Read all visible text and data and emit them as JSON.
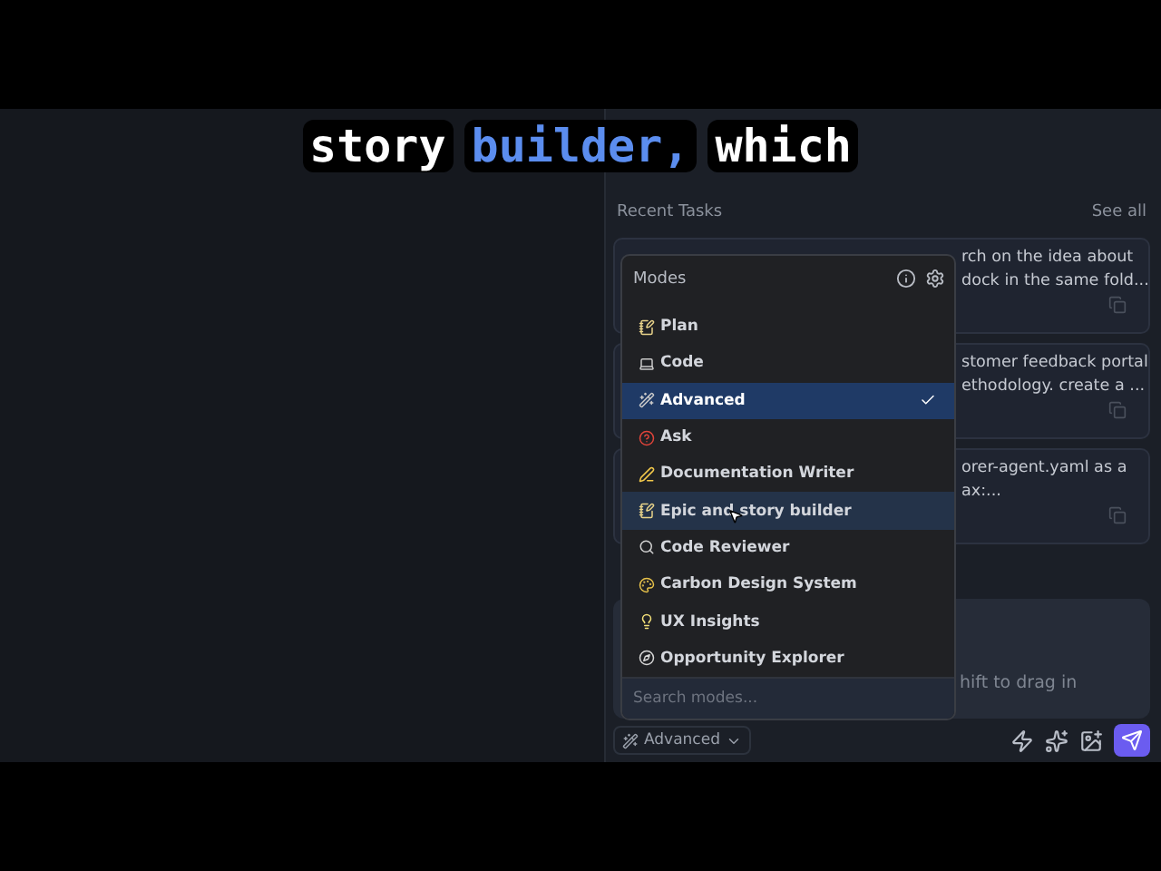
{
  "caption": {
    "words": [
      {
        "text": "story",
        "highlighted": false
      },
      {
        "text": "builder,",
        "highlighted": true
      },
      {
        "text": "which",
        "highlighted": false
      }
    ]
  },
  "recent_tasks": {
    "title": "Recent Tasks",
    "see_all": "See all",
    "tasks": [
      {
        "lines": [
          "rch on the idea about",
          "dock in the same fold..."
        ]
      },
      {
        "lines": [
          "stomer feedback portal",
          "ethodology. create a ..."
        ]
      },
      {
        "lines": [
          "orer-agent.yaml as a",
          "ax:..."
        ]
      }
    ]
  },
  "input": {
    "hint": "hift to drag in"
  },
  "modes_menu": {
    "title": "Modes",
    "items": [
      {
        "label": "Plan",
        "selected": false,
        "hovered": false
      },
      {
        "label": "Code",
        "selected": false,
        "hovered": false
      },
      {
        "label": "Advanced",
        "selected": true,
        "hovered": false
      },
      {
        "label": "Ask",
        "selected": false,
        "hovered": false
      },
      {
        "label": "Documentation Writer",
        "selected": false,
        "hovered": false
      },
      {
        "label": "Epic and story builder",
        "selected": false,
        "hovered": true
      },
      {
        "label": "Code Reviewer",
        "selected": false,
        "hovered": false
      },
      {
        "label": "Carbon Design System",
        "selected": false,
        "hovered": false
      },
      {
        "label": "UX Insights",
        "selected": false,
        "hovered": false
      },
      {
        "label": "Opportunity Explorer",
        "selected": false,
        "hovered": false
      }
    ],
    "search": {
      "placeholder": "Search modes..."
    }
  },
  "toolbar": {
    "mode": "Advanced"
  }
}
